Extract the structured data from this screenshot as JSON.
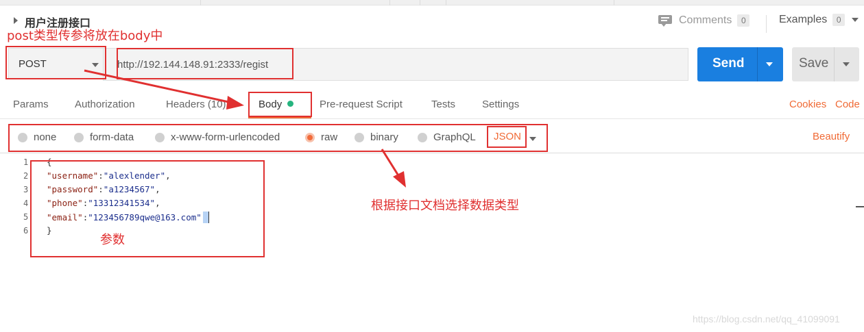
{
  "request": {
    "name": "用户注册接口",
    "method": "POST",
    "url": "http://192.144.148.91:2333/regist"
  },
  "header": {
    "comments_label": "Comments",
    "comments_count": "0",
    "examples_label": "Examples",
    "examples_count": "0"
  },
  "buttons": {
    "send": "Send",
    "save": "Save"
  },
  "tabs": [
    {
      "label": "Params"
    },
    {
      "label": "Authorization"
    },
    {
      "label": "Headers (10)"
    },
    {
      "label": "Body"
    },
    {
      "label": "Pre-request Script"
    },
    {
      "label": "Tests"
    },
    {
      "label": "Settings"
    }
  ],
  "tab_links": {
    "cookies": "Cookies",
    "code": "Code"
  },
  "body_types": [
    {
      "label": "none"
    },
    {
      "label": "form-data"
    },
    {
      "label": "x-www-form-urlencoded"
    },
    {
      "label": "raw"
    },
    {
      "label": "binary"
    },
    {
      "label": "GraphQL"
    }
  ],
  "selected_body_type": "raw",
  "raw_format": "JSON",
  "beautify_label": "Beautify",
  "editor": {
    "line_numbers": [
      "1",
      "2",
      "3",
      "4",
      "5",
      "6"
    ],
    "lines": [
      {
        "key": "",
        "value": "",
        "text": "{"
      },
      {
        "key": "\"username\"",
        "value": "\"alexlender\"",
        "suffix": ","
      },
      {
        "key": "\"password\"",
        "value": "\"a1234567\"",
        "suffix": ","
      },
      {
        "key": "\"phone\"",
        "value": "\"13312341534\"",
        "suffix": ","
      },
      {
        "key": "\"email\"",
        "value": "\"123456789qwe@163.com\"",
        "suffix": ""
      },
      {
        "key": "",
        "value": "",
        "text": "}"
      }
    ]
  },
  "annotations": {
    "post_note": "post类型传参将放在body中",
    "params_note": "参数",
    "choose_note": "根据接口文档选择数据类型"
  },
  "watermark": "https://blog.csdn.net/qq_41099091",
  "colors": {
    "accent_orange": "#f06a35",
    "send_blue": "#1a7fe0",
    "annotation_red": "#e03030",
    "body_dot_green": "#26b47f"
  }
}
